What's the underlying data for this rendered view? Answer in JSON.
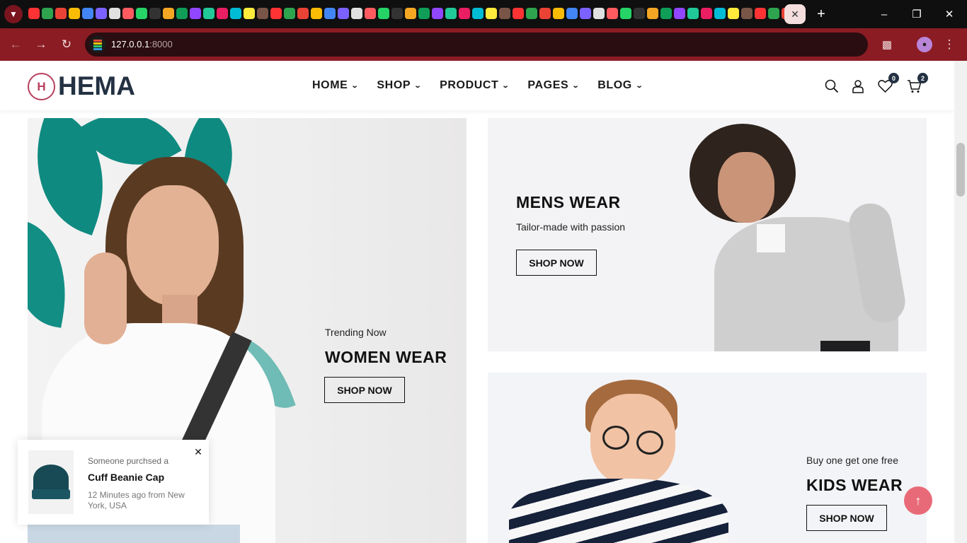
{
  "browser": {
    "url_host": "127.0.0.1",
    "url_port": ":8000",
    "accent": "#8b1c24"
  },
  "header": {
    "logo_text": "HEMA",
    "nav": [
      {
        "label": "HOME"
      },
      {
        "label": "SHOP"
      },
      {
        "label": "PRODUCT"
      },
      {
        "label": "PAGES"
      },
      {
        "label": "BLOG"
      }
    ],
    "wishlist_count": "0",
    "cart_count": "2"
  },
  "banners": {
    "women": {
      "subtitle": "Trending Now",
      "title": "WOMEN WEAR",
      "button": "SHOP NOW"
    },
    "men": {
      "title": "MENS WEAR",
      "subtitle": "Tailor-made with passion",
      "button": "SHOP NOW"
    },
    "kids": {
      "subtitle": "Buy one get one free",
      "title": "KIDS WEAR",
      "button": "SHOP NOW"
    }
  },
  "purchase_popup": {
    "line1": "Someone purchsed a",
    "product": "Cuff Beanie Cap",
    "meta": "12 Minutes ago from New York, USA"
  }
}
